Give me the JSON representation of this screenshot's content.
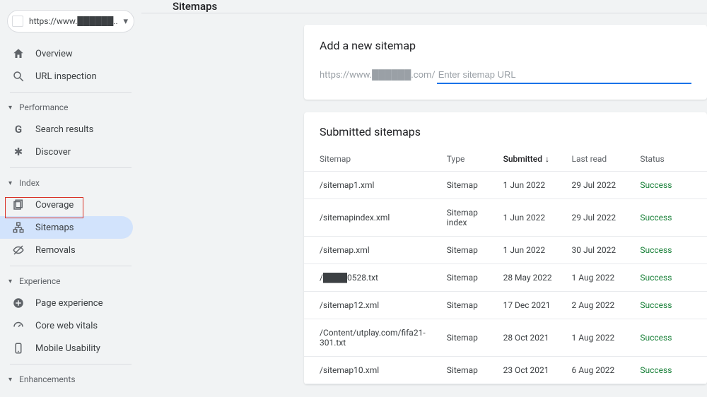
{
  "site_picker": {
    "label": "https://www.██████.."
  },
  "sidebar": {
    "top": [
      {
        "label": "Overview"
      },
      {
        "label": "URL inspection"
      }
    ],
    "sections": [
      {
        "title": "Performance",
        "items": [
          {
            "label": "Search results"
          },
          {
            "label": "Discover"
          }
        ]
      },
      {
        "title": "Index",
        "items": [
          {
            "label": "Coverage"
          },
          {
            "label": "Sitemaps"
          },
          {
            "label": "Removals"
          }
        ]
      },
      {
        "title": "Experience",
        "items": [
          {
            "label": "Page experience"
          },
          {
            "label": "Core web vitals"
          },
          {
            "label": "Mobile Usability"
          }
        ]
      },
      {
        "title": "Enhancements",
        "items": []
      }
    ]
  },
  "page": {
    "title": "Sitemaps"
  },
  "add_card": {
    "title": "Add a new sitemap",
    "url_prefix": "https://www.██████.com/",
    "placeholder": "Enter sitemap URL"
  },
  "submitted": {
    "title": "Submitted sitemaps",
    "columns": {
      "sitemap": "Sitemap",
      "type": "Type",
      "submitted": "Submitted",
      "last_read": "Last read",
      "status": "Status"
    },
    "rows": [
      {
        "sitemap": "/sitemap1.xml",
        "type": "Sitemap",
        "submitted": "1 Jun 2022",
        "last_read": "29 Jul 2022",
        "status": "Success"
      },
      {
        "sitemap": "/sitemapindex.xml",
        "type": "Sitemap index",
        "submitted": "1 Jun 2022",
        "last_read": "29 Jul 2022",
        "status": "Success"
      },
      {
        "sitemap": "/sitemap.xml",
        "type": "Sitemap",
        "submitted": "1 Jun 2022",
        "last_read": "30 Jul 2022",
        "status": "Success"
      },
      {
        "sitemap": "/████0528.txt",
        "type": "Sitemap",
        "submitted": "28 May 2022",
        "last_read": "1 Aug 2022",
        "status": "Success"
      },
      {
        "sitemap": "/sitemap12.xml",
        "type": "Sitemap",
        "submitted": "17 Dec 2021",
        "last_read": "2 Aug 2022",
        "status": "Success"
      },
      {
        "sitemap": "/Content/utplay.com/fifa21-301.txt",
        "type": "Sitemap",
        "submitted": "28 Oct 2021",
        "last_read": "1 Aug 2022",
        "status": "Success"
      },
      {
        "sitemap": "/sitemap10.xml",
        "type": "Sitemap",
        "submitted": "23 Oct 2021",
        "last_read": "6 Aug 2022",
        "status": "Success"
      }
    ]
  }
}
